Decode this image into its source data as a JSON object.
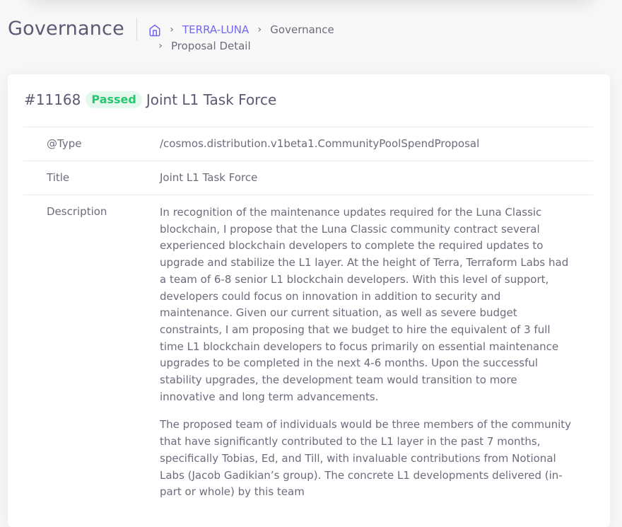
{
  "header": {
    "title": "Governance",
    "breadcrumb": {
      "home_icon": "home-icon",
      "chain": "TERRA-LUNA",
      "section": "Governance",
      "current": "Proposal Detail",
      "separator": "›"
    }
  },
  "proposal": {
    "id": "#11168",
    "status": "Passed",
    "status_color": "#28c76f",
    "title": "Joint L1 Task Force",
    "fields": {
      "type_label": "@Type",
      "type_value": "/cosmos.distribution.v1beta1.CommunityPoolSpendProposal",
      "title_label": "Title",
      "title_value": "Joint L1 Task Force",
      "description_label": "Description",
      "description_paragraphs": [
        "In recognition of the maintenance updates required for the Luna Classic blockchain, I propose that the Luna Classic community contract several experienced blockchain developers to complete the required updates to upgrade and stabilize the L1 layer. At the height of Terra, Terraform Labs had a team of 6-8 senior L1 blockchain developers. With this level of support, developers could focus on innovation in addition to security and maintenance. Given our current situation, as well as severe budget constraints, I am proposing that we budget to hire the equivalent of 3 full time L1 blockchain developers to focus primarily on essential maintenance upgrades to be completed in the next 4-6 months. Upon the successful stability upgrades, the development team would transition to more innovative and long term advancements.",
        "The proposed team of individuals would be three members of the community that have significantly contributed to the L1 layer in the past 7 months, specifically Tobias, Ed, and Till, with invaluable contributions from Notional Labs (Jacob Gadikian’s group). The concrete L1 developments delivered (in-part or whole) by this team"
      ]
    }
  },
  "colors": {
    "accent": "#7367f0",
    "text": "#6e6b7b",
    "heading": "#5e5873",
    "success": "#28c76f"
  }
}
